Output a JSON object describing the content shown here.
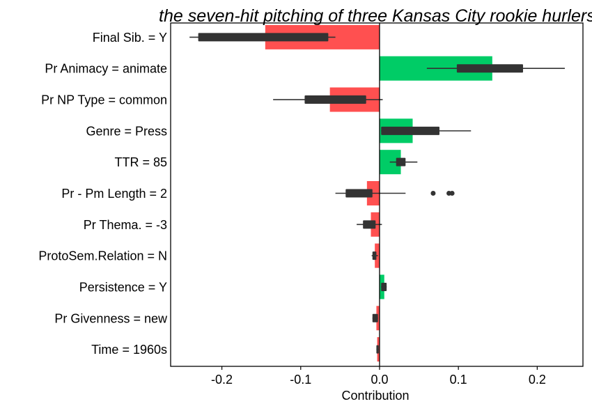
{
  "chart_data": {
    "type": "bar",
    "subtype": "horizontal bar with boxplot overlay",
    "title": "the seven-hit pitching of three Kansas City rookie hurlers",
    "xlabel": "Contribution",
    "ylabel": "",
    "xlim": [
      -0.265,
      0.258
    ],
    "xticks": [
      -0.2,
      -0.1,
      0.0,
      0.1,
      0.2
    ],
    "xtick_labels": [
      "-0.2",
      "-0.1",
      "0.0",
      "0.1",
      "0.2"
    ],
    "grid": false,
    "legend": null,
    "colors": {
      "positive": "#00CC66",
      "negative": "#FF5050",
      "box": "#333333"
    },
    "categories": [
      "Final Sib. = Y",
      "Pr Animacy = animate",
      "Pr NP Type = common",
      "Genre = Press",
      "TTR = 85",
      "Pr - Pm Length = 2",
      "Pr Thema. = -3",
      "ProtoSem.Relation = N",
      "Persistence = Y",
      "Pr Givenness = new",
      "Time = 1960s"
    ],
    "values": [
      -0.145,
      0.143,
      -0.063,
      0.042,
      0.027,
      -0.016,
      -0.011,
      -0.006,
      0.006,
      -0.004,
      -0.003
    ],
    "boxplots": [
      {
        "whisker_low": -0.241,
        "q1": -0.23,
        "q3": -0.065,
        "whisker_high": -0.056,
        "outliers": []
      },
      {
        "whisker_low": 0.06,
        "q1": 0.098,
        "q3": 0.182,
        "whisker_high": 0.235,
        "outliers": []
      },
      {
        "whisker_low": -0.135,
        "q1": -0.095,
        "q3": -0.017,
        "whisker_high": 0.004,
        "outliers": []
      },
      {
        "whisker_low": 0.002,
        "q1": 0.002,
        "q3": 0.076,
        "whisker_high": 0.116,
        "outliers": []
      },
      {
        "whisker_low": 0.013,
        "q1": 0.021,
        "q3": 0.033,
        "whisker_high": 0.048,
        "outliers": []
      },
      {
        "whisker_low": -0.056,
        "q1": -0.043,
        "q3": -0.009,
        "whisker_high": 0.033,
        "outliers": [
          0.068,
          0.088,
          0.092
        ]
      },
      {
        "whisker_low": -0.029,
        "q1": -0.021,
        "q3": -0.005,
        "whisker_high": 0.003,
        "outliers": []
      },
      {
        "whisker_low": -0.01,
        "q1": -0.009,
        "q3": -0.004,
        "whisker_high": -0.002,
        "outliers": []
      },
      {
        "whisker_low": 0.002,
        "q1": 0.002,
        "q3": 0.009,
        "whisker_high": 0.009,
        "outliers": []
      },
      {
        "whisker_low": -0.009,
        "q1": -0.009,
        "q3": -0.002,
        "whisker_high": -0.002,
        "outliers": []
      },
      {
        "whisker_low": -0.004,
        "q1": -0.004,
        "q3": -0.001,
        "whisker_high": -0.001,
        "outliers": []
      }
    ]
  }
}
